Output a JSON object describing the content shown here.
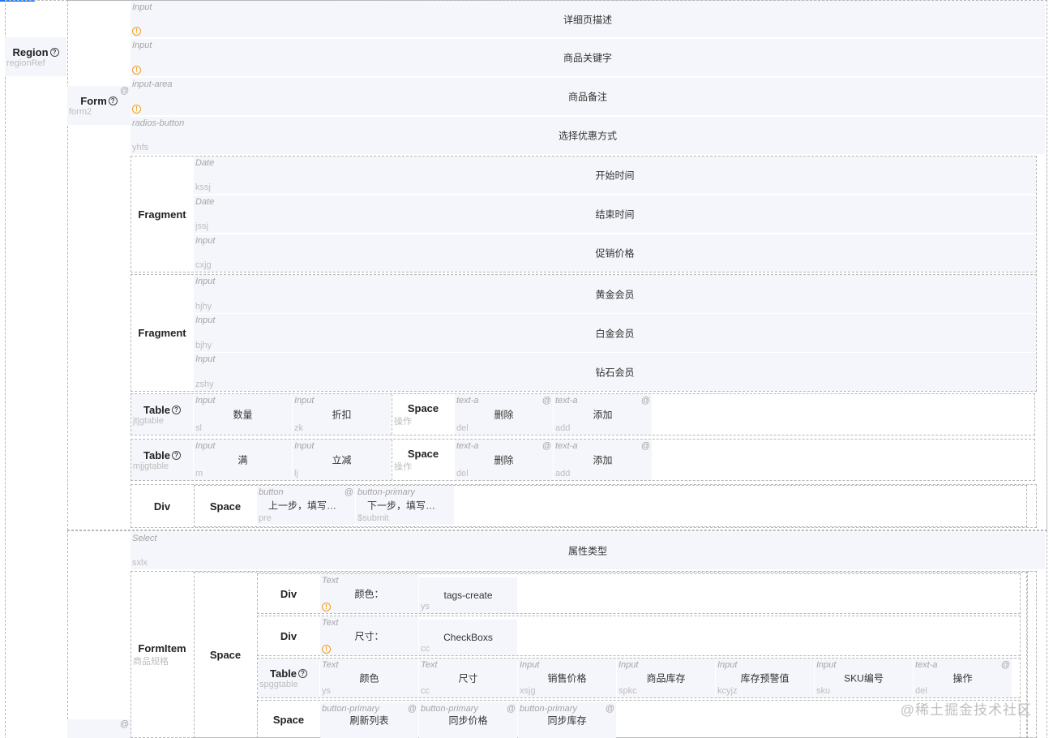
{
  "controls": {
    "region": {
      "name": "Region",
      "ref": "regionRef"
    },
    "form": {
      "name": "Form",
      "ref": "form2"
    },
    "fragment": "Fragment",
    "table1": {
      "name": "Table",
      "ref": "jtjgtable"
    },
    "table2": {
      "name": "Table",
      "ref": "mjjgtable"
    },
    "space": "Space",
    "div": "Div",
    "formitem": {
      "name": "FormItem",
      "ref": "商品规格"
    },
    "table3": {
      "name": "Table",
      "ref": "spggtable"
    },
    "op_ref": "操作"
  },
  "fields": [
    {
      "type": "Input",
      "label": "详细页描述",
      "warn": true
    },
    {
      "type": "Input",
      "label": "商品关键字",
      "warn": true
    },
    {
      "type": "input-area",
      "label": "商品备注",
      "warn": true
    },
    {
      "type": "radios-button",
      "label": "选择优惠方式",
      "key": "yhfs"
    }
  ],
  "fragment1": [
    {
      "type": "Date",
      "label": "开始时间",
      "key": "kssj"
    },
    {
      "type": "Date",
      "label": "结束时间",
      "key": "jssj"
    },
    {
      "type": "Input",
      "label": "促销价格",
      "key": "cxjg"
    }
  ],
  "fragment2": [
    {
      "type": "Input",
      "label": "黄金会员",
      "key": "hjhy"
    },
    {
      "type": "Input",
      "label": "白金会员",
      "key": "bjhy"
    },
    {
      "type": "Input",
      "label": "钻石会员",
      "key": "zshy"
    }
  ],
  "table1_cols": [
    {
      "type": "Input",
      "label": "数量",
      "key": "sl"
    },
    {
      "type": "Input",
      "label": "折扣",
      "key": "zk"
    }
  ],
  "table2_cols": [
    {
      "type": "Input",
      "label": "满",
      "key": "m"
    },
    {
      "type": "Input",
      "label": "立减",
      "key": "lj"
    }
  ],
  "ops": [
    {
      "type": "text-a",
      "label": "删除",
      "key": "del"
    },
    {
      "type": "text-a",
      "label": "添加",
      "key": "add"
    }
  ],
  "buttons": [
    {
      "type": "button",
      "label": "上一步，填写商...",
      "key": "pre"
    },
    {
      "type": "button-primary",
      "label": "下一步，填写商...",
      "key": "$submit"
    }
  ],
  "select": {
    "type": "Select",
    "label": "属性类型",
    "key": "sxlx"
  },
  "spec_rows": [
    {
      "type": "Text",
      "label": "颜色：",
      "value": "tags-create",
      "key": "ys"
    },
    {
      "type": "Text",
      "label": "尺寸：",
      "value": "CheckBoxs",
      "key": "cc"
    }
  ],
  "table3_cols": [
    {
      "type": "Text",
      "label": "颜色",
      "key": "ys"
    },
    {
      "type": "Text",
      "label": "尺寸",
      "key": "cc"
    },
    {
      "type": "Input",
      "label": "销售价格",
      "key": "xsjg"
    },
    {
      "type": "Input",
      "label": "商品库存",
      "key": "spkc"
    },
    {
      "type": "Input",
      "label": "库存预警值",
      "key": "kcyjz"
    },
    {
      "type": "Input",
      "label": "SKU编号",
      "key": "sku"
    },
    {
      "type": "text-a",
      "label": "操作",
      "key": "del"
    }
  ],
  "bottom_buttons": [
    {
      "type": "button-primary",
      "label": "刷新列表"
    },
    {
      "type": "button-primary",
      "label": "同步价格"
    },
    {
      "type": "button-primary",
      "label": "同步库存"
    }
  ],
  "at_symbol": "@",
  "warn_glyph": "!",
  "q_glyph": "?",
  "watermark": "@稀土掘金技术社区",
  "accent": "#1677ff"
}
